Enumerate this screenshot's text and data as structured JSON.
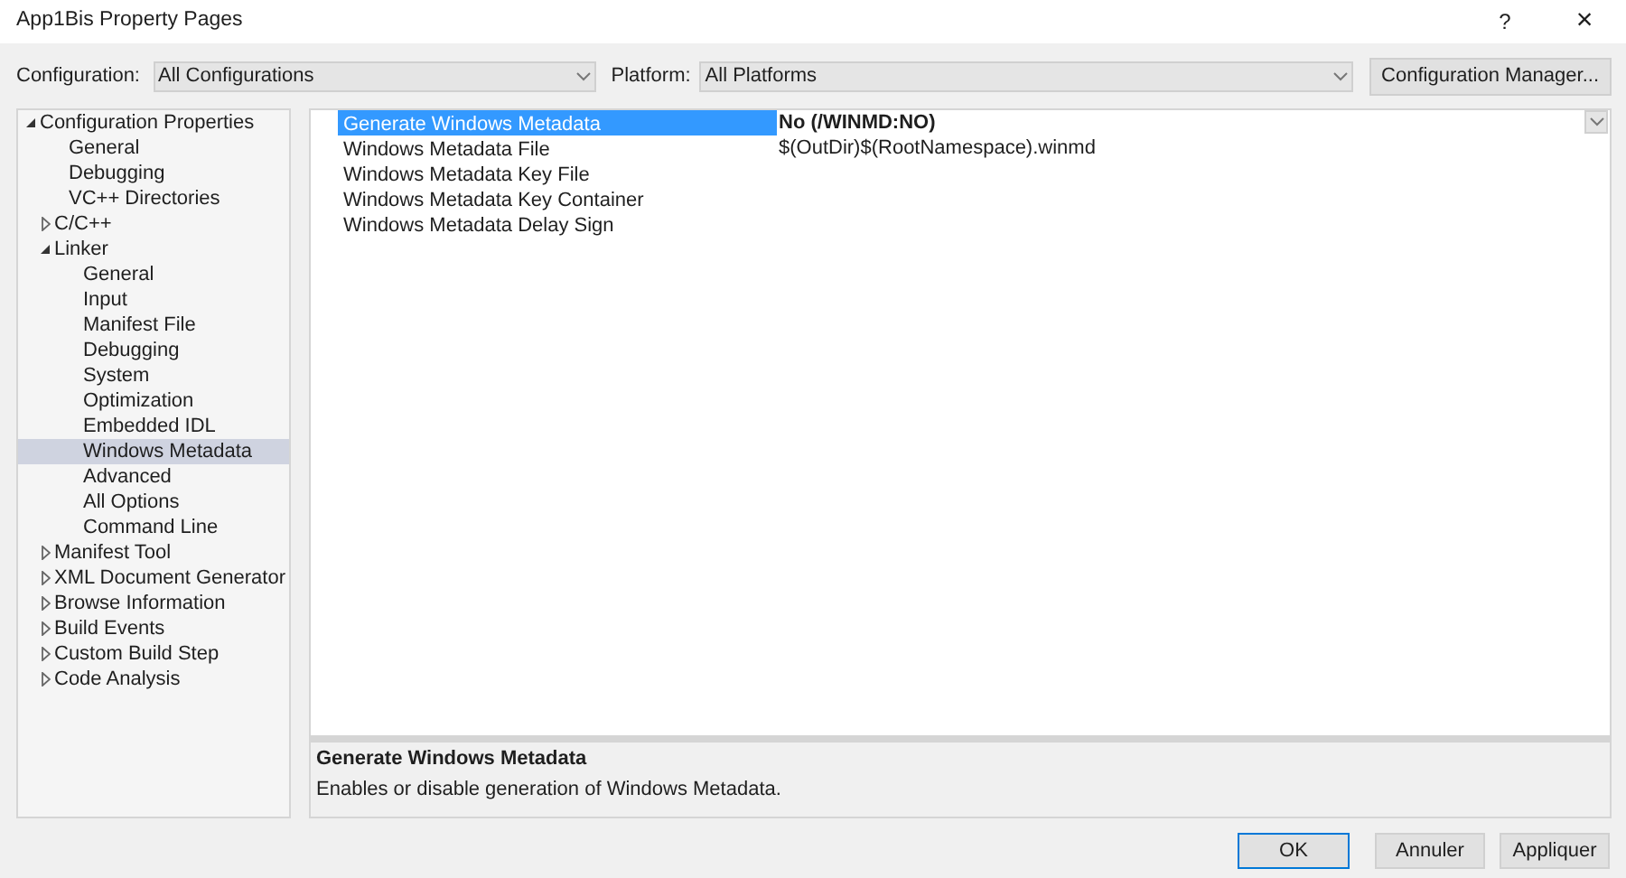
{
  "window": {
    "title": "App1Bis Property Pages",
    "help": "?",
    "close": "×"
  },
  "configuration": {
    "label": "Configuration:",
    "value": "All Configurations"
  },
  "platform": {
    "label": "Platform:",
    "value": "All Platforms"
  },
  "configuration_manager": "Configuration Manager...",
  "tree": [
    {
      "label": "Configuration Properties",
      "expanded": true,
      "selected": false,
      "children": [
        {
          "label": "General",
          "selected": false
        },
        {
          "label": "Debugging",
          "selected": false
        },
        {
          "label": "VC++ Directories",
          "selected": false
        },
        {
          "label": "C/C++",
          "expanded": false,
          "selected": false
        },
        {
          "label": "Linker",
          "expanded": true,
          "selected": false,
          "children": [
            {
              "label": "General",
              "selected": false
            },
            {
              "label": "Input",
              "selected": false
            },
            {
              "label": "Manifest File",
              "selected": false
            },
            {
              "label": "Debugging",
              "selected": false
            },
            {
              "label": "System",
              "selected": false
            },
            {
              "label": "Optimization",
              "selected": false
            },
            {
              "label": "Embedded IDL",
              "selected": false
            },
            {
              "label": "Windows Metadata",
              "selected": true
            },
            {
              "label": "Advanced",
              "selected": false
            },
            {
              "label": "All Options",
              "selected": false
            },
            {
              "label": "Command Line",
              "selected": false
            }
          ]
        },
        {
          "label": "Manifest Tool",
          "expanded": false,
          "selected": false
        },
        {
          "label": "XML Document Generator",
          "expanded": false,
          "selected": false
        },
        {
          "label": "Browse Information",
          "expanded": false,
          "selected": false
        },
        {
          "label": "Build Events",
          "expanded": false,
          "selected": false
        },
        {
          "label": "Custom Build Step",
          "expanded": false,
          "selected": false
        },
        {
          "label": "Code Analysis",
          "expanded": false,
          "selected": false
        }
      ]
    }
  ],
  "properties": [
    {
      "name": "Generate Windows Metadata",
      "value": "No (/WINMD:NO)",
      "selected": true,
      "modified": true
    },
    {
      "name": "Windows Metadata File",
      "value": "$(OutDir)$(RootNamespace).winmd",
      "selected": false,
      "modified": false
    },
    {
      "name": "Windows Metadata Key File",
      "selected": false
    },
    {
      "name": "Windows Metadata Key Container",
      "selected": false
    },
    {
      "name": "Windows Metadata Delay Sign",
      "selected": false
    }
  ],
  "description": {
    "title": "Generate Windows Metadata",
    "text": "Enables or disable generation of Windows Metadata."
  },
  "buttons": [
    {
      "label": "OK",
      "default": true
    },
    {
      "label": "Annuler",
      "default": false
    },
    {
      "label": "Appliquer",
      "default": false
    }
  ]
}
